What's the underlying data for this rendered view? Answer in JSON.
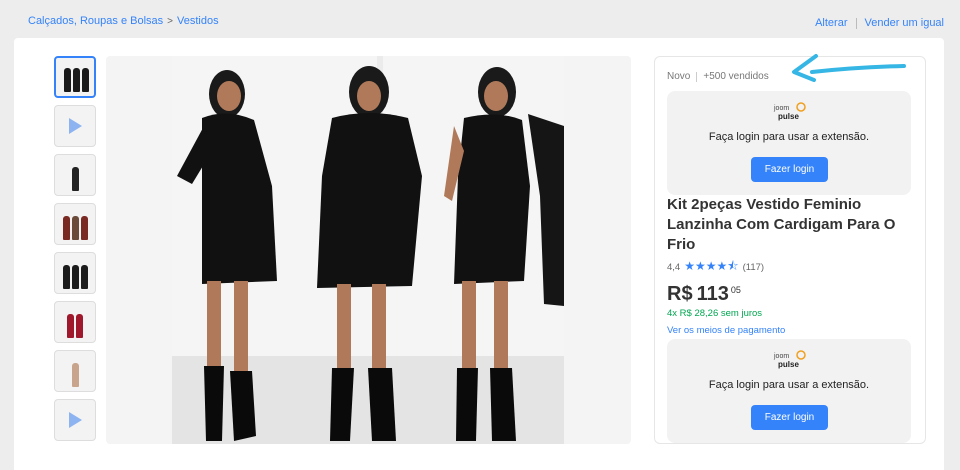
{
  "breadcrumb": {
    "items": [
      "Calçados, Roupas e Bolsas",
      "Vestidos"
    ],
    "separator": ">"
  },
  "top_links": {
    "change": "Alterar",
    "sell": "Vender um igual"
  },
  "product": {
    "condition": "Novo",
    "sold": "+500 vendidos",
    "title": "Kit 2peças Vestido Feminio Lanzinha Com Cardigam Para O Frio",
    "rating": {
      "score": "4,4",
      "count": "(117)",
      "stars": "★★★★⯪"
    },
    "price": {
      "currency": "R$",
      "whole": "113",
      "cents": "05"
    },
    "installments": "4x R$ 28,26 sem juros",
    "payment_link": "Ver os meios de pagamento"
  },
  "extension": {
    "logo_top": "joom",
    "logo_bottom": "pulse",
    "message": "Faça login para usar a extensão.",
    "button": "Fazer login"
  },
  "thumbnails": [
    {
      "kind": "photo",
      "colors": [
        "#1a1a1a",
        "#1a1a1a",
        "#1a1a1a"
      ]
    },
    {
      "kind": "video"
    },
    {
      "kind": "photo",
      "colors": [
        "#222222"
      ]
    },
    {
      "kind": "photo",
      "colors": [
        "#7a2a22",
        "#6b4a3a",
        "#7a2a22"
      ]
    },
    {
      "kind": "photo",
      "colors": [
        "#1c1c1c",
        "#1c1c1c",
        "#1c1c1c"
      ]
    },
    {
      "kind": "photo",
      "colors": [
        "#a0182b",
        "#a0182b"
      ]
    },
    {
      "kind": "photo",
      "colors": [
        "#c9a48c"
      ]
    },
    {
      "kind": "video"
    }
  ],
  "colors": {
    "accent": "#3483fa",
    "green": "#00a650",
    "annotation_arrow": "#35b6e4"
  }
}
